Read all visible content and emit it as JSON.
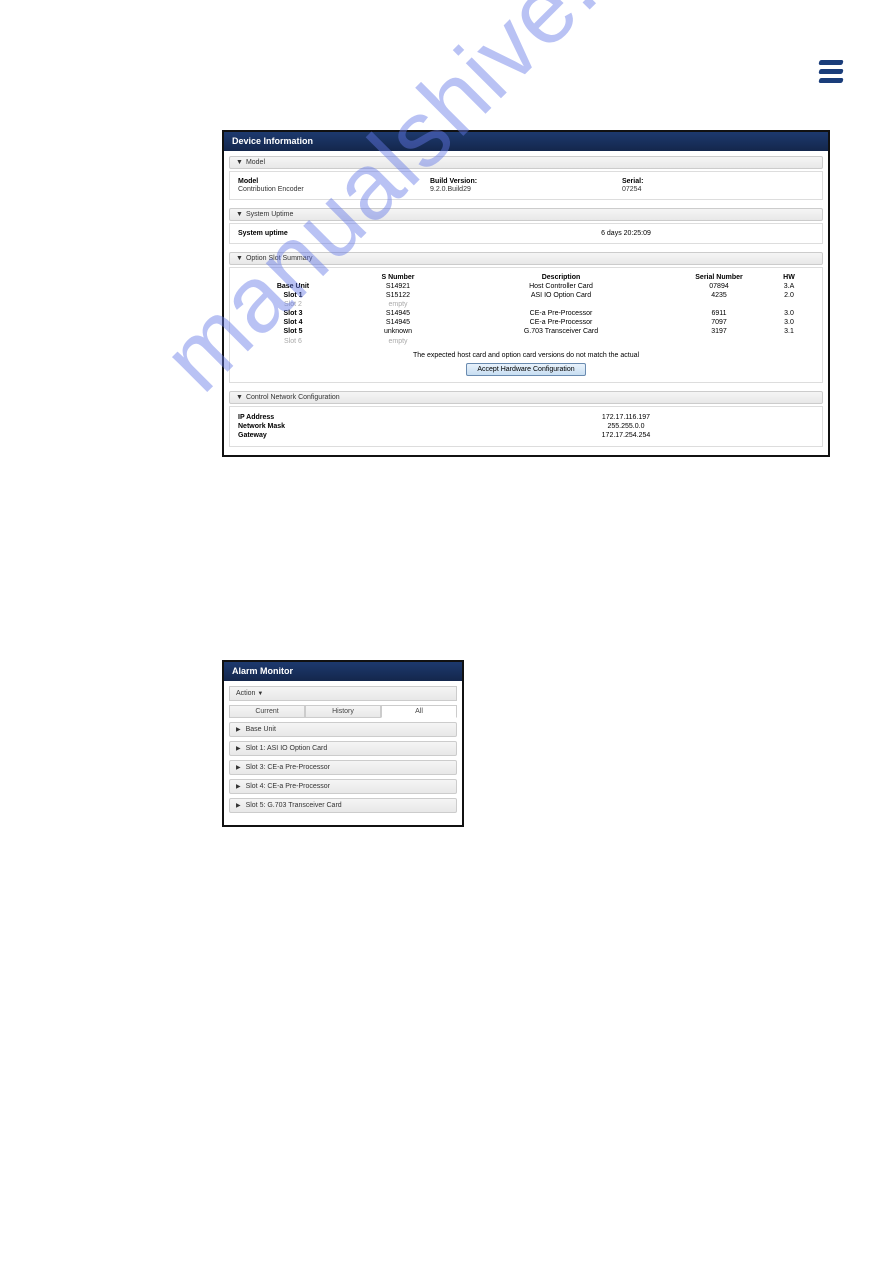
{
  "logo_name": "ericsson-logo",
  "watermark": "manualshive.com",
  "device_info": {
    "title": "Device Information",
    "sections": {
      "model": {
        "header": "Model",
        "model_label": "Model",
        "model_value": "Contribution Encoder",
        "build_label": "Build Version:",
        "build_value": "9.2.0.Build29",
        "serial_label": "Serial:",
        "serial_value": "07254"
      },
      "uptime": {
        "header": "System Uptime",
        "label": "System uptime",
        "value": "6 days 20:25:09"
      },
      "slots": {
        "header": "Option Slot Summary",
        "columns": [
          "",
          "S Number",
          "Description",
          "Serial Number",
          "HW"
        ],
        "rows": [
          {
            "name": "Base Unit",
            "sn": "S14921",
            "desc": "Host Controller Card",
            "serial": "07894",
            "hw": "3.A",
            "bold": true
          },
          {
            "name": "Slot 1",
            "sn": "S15122",
            "desc": "ASI IO Option Card",
            "serial": "4235",
            "hw": "2.0",
            "bold": true
          },
          {
            "name": "Slot 2",
            "sn": "empty",
            "desc": "",
            "serial": "",
            "hw": "",
            "grey": true
          },
          {
            "name": "Slot 3",
            "sn": "S14945",
            "desc": "CE-a Pre-Processor",
            "serial": "6911",
            "hw": "3.0",
            "bold": true
          },
          {
            "name": "Slot 4",
            "sn": "S14945",
            "desc": "CE-a Pre-Processor",
            "serial": "7097",
            "hw": "3.0",
            "bold": true
          },
          {
            "name": "Slot 5",
            "sn": "unknown",
            "desc": "G.703 Transceiver Card",
            "serial": "3197",
            "hw": "3.1",
            "bold": true
          },
          {
            "name": "Slot 6",
            "sn": "empty",
            "desc": "",
            "serial": "",
            "hw": "",
            "grey": true
          }
        ],
        "note": "The expected host card and option card versions do not match the actual",
        "button": "Accept Hardware Configuration"
      },
      "network": {
        "header": "Control Network Configuration",
        "rows": [
          {
            "label": "IP Address",
            "value": "172.17.116.197"
          },
          {
            "label": "Network Mask",
            "value": "255.255.0.0"
          },
          {
            "label": "Gateway",
            "value": "172.17.254.254"
          }
        ]
      }
    }
  },
  "alarm_monitor": {
    "title": "Alarm Monitor",
    "action_label": "Action",
    "tabs": [
      "Current",
      "History",
      "All"
    ],
    "active_tab": 2,
    "items": [
      "Base Unit",
      "Slot 1: ASI IO Option Card",
      "Slot 3: CE-a Pre-Processor",
      "Slot 4: CE-a Pre-Processor",
      "Slot 5: G.703 Transceiver Card"
    ]
  }
}
